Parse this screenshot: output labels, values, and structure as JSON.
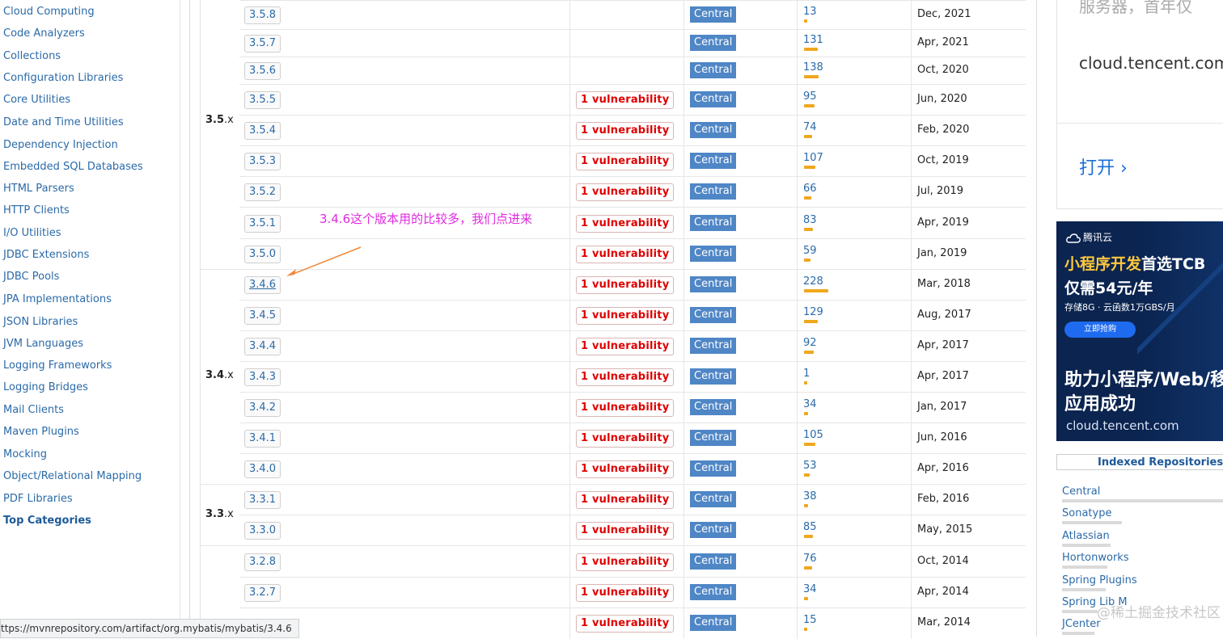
{
  "sidebar": {
    "items": [
      "Cloud Computing",
      "Code Analyzers",
      "Collections",
      "Configuration Libraries",
      "Core Utilities",
      "Date and Time Utilities",
      "Dependency Injection",
      "Embedded SQL Databases",
      "HTML Parsers",
      "HTTP Clients",
      "I/O Utilities",
      "JDBC Extensions",
      "JDBC Pools",
      "JPA Implementations",
      "JSON Libraries",
      "JVM Languages",
      "Logging Frameworks",
      "Logging Bridges",
      "Mail Clients",
      "Maven Plugins",
      "Mocking",
      "Object/Relational Mapping",
      "PDF Libraries"
    ],
    "top_categories": "Top Categories"
  },
  "versions": {
    "groups": [
      {
        "label_bold": "3.5",
        "label_rest": ".x"
      },
      {
        "label_bold": "3.4",
        "label_rest": ".x"
      },
      {
        "label_bold": "3.3",
        "label_rest": ".x"
      }
    ],
    "rows": [
      {
        "version": "3.5.8",
        "vuln": "",
        "repo": "Central",
        "usages": "13",
        "usage_level": 0.06,
        "date": "Dec, 2021"
      },
      {
        "version": "3.5.7",
        "vuln": "",
        "repo": "Central",
        "usages": "131",
        "usage_level": 0.57,
        "date": "Apr, 2021"
      },
      {
        "version": "3.5.6",
        "vuln": "",
        "repo": "Central",
        "usages": "138",
        "usage_level": 0.61,
        "date": "Oct, 2020"
      },
      {
        "version": "3.5.5",
        "vuln": "1 vulnerability",
        "repo": "Central",
        "usages": "95",
        "usage_level": 0.42,
        "date": "Jun, 2020"
      },
      {
        "version": "3.5.4",
        "vuln": "1 vulnerability",
        "repo": "Central",
        "usages": "74",
        "usage_level": 0.33,
        "date": "Feb, 2020"
      },
      {
        "version": "3.5.3",
        "vuln": "1 vulnerability",
        "repo": "Central",
        "usages": "107",
        "usage_level": 0.47,
        "date": "Oct, 2019"
      },
      {
        "version": "3.5.2",
        "vuln": "1 vulnerability",
        "repo": "Central",
        "usages": "66",
        "usage_level": 0.29,
        "date": "Jul, 2019"
      },
      {
        "version": "3.5.1",
        "vuln": "1 vulnerability",
        "repo": "Central",
        "usages": "83",
        "usage_level": 0.37,
        "date": "Apr, 2019"
      },
      {
        "version": "3.5.0",
        "vuln": "1 vulnerability",
        "repo": "Central",
        "usages": "59",
        "usage_level": 0.26,
        "date": "Jan, 2019"
      },
      {
        "version": "3.4.6",
        "vuln": "1 vulnerability",
        "repo": "Central",
        "usages": "228",
        "usage_level": 1.0,
        "date": "Mar, 2018"
      },
      {
        "version": "3.4.5",
        "vuln": "1 vulnerability",
        "repo": "Central",
        "usages": "129",
        "usage_level": 0.57,
        "date": "Aug, 2017"
      },
      {
        "version": "3.4.4",
        "vuln": "1 vulnerability",
        "repo": "Central",
        "usages": "92",
        "usage_level": 0.4,
        "date": "Apr, 2017"
      },
      {
        "version": "3.4.3",
        "vuln": "1 vulnerability",
        "repo": "Central",
        "usages": "1",
        "usage_level": 0.02,
        "date": "Apr, 2017"
      },
      {
        "version": "3.4.2",
        "vuln": "1 vulnerability",
        "repo": "Central",
        "usages": "34",
        "usage_level": 0.15,
        "date": "Jan, 2017"
      },
      {
        "version": "3.4.1",
        "vuln": "1 vulnerability",
        "repo": "Central",
        "usages": "105",
        "usage_level": 0.46,
        "date": "Jun, 2016"
      },
      {
        "version": "3.4.0",
        "vuln": "1 vulnerability",
        "repo": "Central",
        "usages": "53",
        "usage_level": 0.23,
        "date": "Apr, 2016"
      },
      {
        "version": "3.3.1",
        "vuln": "1 vulnerability",
        "repo": "Central",
        "usages": "38",
        "usage_level": 0.17,
        "date": "Feb, 2016"
      },
      {
        "version": "3.3.0",
        "vuln": "1 vulnerability",
        "repo": "Central",
        "usages": "85",
        "usage_level": 0.37,
        "date": "May, 2015"
      },
      {
        "version": "3.2.8",
        "vuln": "1 vulnerability",
        "repo": "Central",
        "usages": "76",
        "usage_level": 0.33,
        "date": "Oct, 2014"
      },
      {
        "version": "3.2.7",
        "vuln": "1 vulnerability",
        "repo": "Central",
        "usages": "34",
        "usage_level": 0.15,
        "date": "Apr, 2014"
      },
      {
        "version": "",
        "vuln": "1 vulnerability",
        "repo": "Central",
        "usages": "15",
        "usage_level": 0.07,
        "date": "Mar, 2014"
      }
    ]
  },
  "annotation": "3.4.6这个版本用的比较多，我们点进来",
  "ad_top": {
    "line1": "服务器，首年仅",
    "line2": "cloud.tencent.com",
    "open": "打开"
  },
  "ad_banner": {
    "brand": "腾讯云",
    "headline_yellow": "小程序开发",
    "headline_white": "首选TCB",
    "price": "仅需54元/年",
    "spec": "存储8G · 云函数1万GBS/月",
    "button": "立即抢购",
    "slogan1": "助力小程序/Web/移",
    "slogan2": "应用成功",
    "domain": "cloud.tencent.com"
  },
  "repositories": {
    "title": "Indexed Repositories",
    "items": [
      {
        "name": "Central",
        "level": 1.0
      },
      {
        "name": "Sonatype",
        "level": 0.37
      },
      {
        "name": "Atlassian",
        "level": 0.3
      },
      {
        "name": "Hortonworks",
        "level": 0.28
      },
      {
        "name": "Spring Plugins",
        "level": 0.27
      },
      {
        "name": "Spring Lib M",
        "level": 0.22
      },
      {
        "name": "JCenter",
        "level": 0.2
      }
    ]
  },
  "status_url": "ttps://mvnrepository.com/artifact/org.mybatis/mybatis/3.4.6",
  "watermark": "@稀土掘金技术社区",
  "colors": {
    "link": "#2b6aa8",
    "vuln": "#e00000",
    "repo_badge": "#4f86c6",
    "usage_bar": "#f0a71e",
    "annotation": "#e02be0"
  }
}
